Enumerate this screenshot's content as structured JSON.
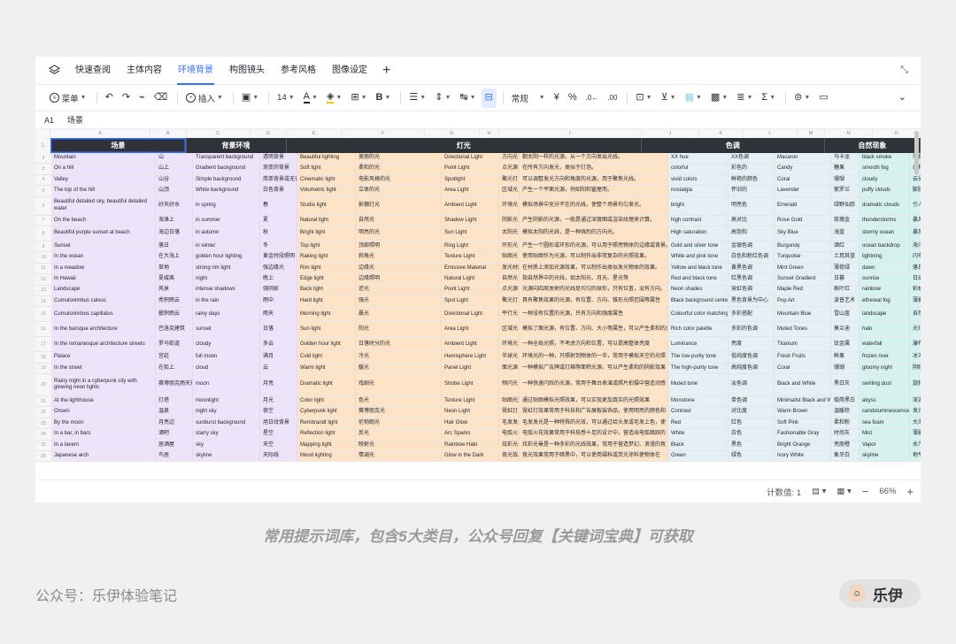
{
  "tabs": [
    "快速查阅",
    "主体内容",
    "环境背景",
    "构图镜头",
    "参考风格",
    "图像设定"
  ],
  "active_tab": "环境背景",
  "toolbar": {
    "menu": "菜单",
    "insert": "插入",
    "font_size": "14",
    "format": "常规",
    "currency": "¥",
    "percent": "%"
  },
  "formula": {
    "ref": "A1",
    "value": "场景"
  },
  "col_letters": [
    "A",
    "B",
    "C",
    "D",
    "E",
    "F",
    "G",
    "H",
    "I",
    "J",
    "K",
    "L",
    "M",
    "N",
    "O"
  ],
  "groups": [
    "场景",
    "背景环境",
    "灯光",
    "色调",
    "自然现象"
  ],
  "rows": [
    [
      "2",
      "Mountain",
      "山",
      "Transparent background",
      "透明背景",
      "Beautiful lighting",
      "美丽的光",
      "Directional Light",
      "方向光",
      "朝太阳一样的光源，从一个方向发出光线。",
      "XX hue",
      "XX色调",
      "Macaron",
      "马卡龙",
      "black smoke",
      "黑色烟雾，也可换成其"
    ],
    [
      "3",
      "On a hill",
      "山上",
      "Gradient background",
      "渐变的背景",
      "Soft light",
      "柔和的光",
      "Point Light",
      "点光源",
      "在所有方向发光，类似于灯泡。",
      "colorful",
      "彩色的",
      "Candy",
      "糖果",
      "smooth fog",
      "柔和的雾"
    ],
    [
      "4",
      "Valley",
      "山谷",
      "Simple background",
      "简单背景或无背景",
      "Cinematic light",
      "电影风格的光",
      "Spotlight",
      "聚光灯",
      "可以调整发光方向和角度的光源，用于聚焦光线。",
      "vivid colors",
      "鲜艳的颜色",
      "Coral",
      "珊瑚",
      "cloudy",
      "云朵"
    ],
    [
      "5",
      "The top of the hill",
      "山顶",
      "White background",
      "白色背景",
      "Volumetric light",
      "立体的光",
      "Area Light",
      "区域光",
      "产生一个平面光源，例如阳和窗屋而。",
      "nostalgia",
      "怀旧的",
      "Lavender",
      "紫罗兰",
      "puffy clouds",
      "膨胀的云"
    ],
    [
      "6",
      "Beautiful detailed sky, beautiful detailed water",
      "好天好水",
      "in spring",
      "春",
      "Studio light",
      "影棚灯光",
      "Ambient Light",
      "环境光",
      "模拟场景中充分不在的光线，使整个场景均匀发光。",
      "bright",
      "明亮色",
      "Emerald",
      "绿野仙踪",
      "dramatic clouds",
      "引人注目的云"
    ],
    [
      "7",
      "On the beach",
      "海滩上",
      "in summer",
      "夏",
      "Natural light",
      "自然光",
      "Shadow Light",
      "阴影光",
      "产生阴影的光源，一般是通过深度图或渲染纹理来计算。",
      "high contrast",
      "高对比",
      "Rose Gold",
      "玫瑰金",
      "thunderstorms",
      "暴风雨"
    ],
    [
      "8",
      "Beautiful purple sunset at beach",
      "海边日落",
      "in autumn",
      "秋",
      "Bright light",
      "明亮的光",
      "Sun Light",
      "太阳光",
      "模拟太阳的光线，是一种强烈的方向光。",
      "High saturation",
      "高饱和",
      "Sky Blue",
      "浅蓝",
      "stormy ocean",
      "暴风雨的海洋"
    ],
    [
      "9",
      "Sunset",
      "落日",
      "in winter",
      "冬",
      "Top light",
      "顶部照明",
      "Ring Light",
      "环形光",
      "产生一个圆形或环形的光源，可以用于照亮物体的边缘或背景。",
      "Gold and silver tone",
      "金银色调",
      "Burgundy",
      "酒红",
      "ocean backdrop",
      "海洋背景"
    ],
    [
      "10",
      "In the ocean",
      "在大海上",
      "golden hour lighting",
      "黄金时段照明",
      "Raking light",
      "斜角光",
      "Texture Light",
      "贴图光",
      "使用贴图作为光源，可以制作出非常复杂的光照效果。",
      "White and pink tone",
      "白色和粉红色调",
      "Turquoise",
      "土耳其蓝",
      "lightning",
      "闪电"
    ],
    [
      "11",
      "In a meadow",
      "草地",
      "strong rim light",
      "强边缘光",
      "Rim light",
      "边缘光",
      "Emissive Material",
      "发光材质",
      "在材质上添加光源效果，可以制作出类似发光物体的效果。",
      "Yellow and black tone",
      "黄黑色调",
      "Mint Green",
      "薄荷绿",
      "dawn",
      "落日"
    ],
    [
      "12",
      "In Hawaii",
      "夏威夷",
      "night",
      "晚上",
      "Edge light",
      "边缘照明",
      "Natural Light",
      "自然光",
      "指自然界中的光线，如太阳光、月光、星光等",
      "Red and black tone",
      "红黑色调",
      "Sunset Gradient",
      "日暮",
      "sunrise",
      "日出"
    ],
    [
      "13",
      "Landscape",
      "风景",
      "intense shadows",
      "强阴影",
      "Back light",
      "逆光",
      "Point Light",
      "点光源",
      "光源向四周发射的光线是均匀的球形，只有位置，没有方向。",
      "Neon shades",
      "霓虹色调",
      "Maple Red",
      "枫叶红",
      "rainbow",
      "彩虹"
    ],
    [
      "14",
      "Cumulonimbus calvus",
      "秃积雨云",
      "in the rain",
      "雨中",
      "Hard light",
      "强光",
      "Spot Light",
      "聚光灯",
      "具有聚焦效果的光源，有位置、方向、锥形光照范围等属性",
      "Black background centered",
      "黑色背景为中心",
      "Pop Art",
      "波普艺术",
      "ethereal fog",
      "薄雾"
    ],
    [
      "15",
      "Cumulonimbus capillatus",
      "鬃积雨云",
      "rainy days",
      "雨天",
      "Morning light",
      "晨光",
      "Directional Light",
      "平行光",
      "一种没有位置的光源，只有方向和强度属性",
      "Colourful color matching",
      "多彩搭配",
      "Mountain Blue",
      "雪山蓝",
      "landscape",
      "自然风景"
    ],
    [
      "16",
      "In the baroque architecture",
      "巴洛克建筑",
      "sunset",
      "日落",
      "Sun light",
      "阳光",
      "Area Light",
      "区域光",
      "模拟了面光源，有位置、方向、大小等属性，可以产生柔和的光",
      "Rich color palette",
      "多彩的色调",
      "Muted Tones",
      "莫兰迪",
      "halo",
      "光环"
    ],
    [
      "17",
      "In the romanesque architecture streets",
      "罗马街道",
      "cloudy",
      "多云",
      "Golden hour light",
      "日落时分的光",
      "Ambient Light",
      "环境光",
      "一种全局光照，不考虑方向和位置，可以提高整体亮度",
      "Luminance",
      "亮度",
      "Titanium",
      "钛金属",
      "waterfall",
      "瀑布"
    ],
    [
      "18",
      "Palace",
      "宫廷",
      "full moon",
      "满月",
      "Cold light",
      "冷光",
      "Hemisphere Light",
      "半球光",
      "环境光的一种，只照射到物体的一半，常用于模拟天空的光照",
      "The low-purity tone",
      "低纯度色调",
      "Fresh Fruits",
      "鲜果",
      "frozen river",
      "冰河"
    ],
    [
      "19",
      "In the street",
      "在街上",
      "cloud",
      "云",
      "Warm light",
      "暖光",
      "Panel Light",
      "面光源",
      "一种模拟广告牌或灯箱等面积光源，可以产生柔和的阴影效果",
      "The high-purity tone",
      "高纯度色调",
      "Coral",
      "珊瑚",
      "gloomy night",
      "阴暗的夜"
    ],
    [
      "20",
      "Rainy night in a cyberpunk city with glowing neon lights",
      "赛博朋克雨天霓虹灯",
      "moon",
      "月亮",
      "Dramatic light",
      "戏剧光",
      "Strobe Light",
      "频闪光",
      "一种快速闪烁的光源，常用于舞台表演或照片拍摄中营造动感",
      "Muted tone",
      "淡色调",
      "Black and White",
      "黑白灰",
      "swirling dust",
      "旋转的尘埃"
    ],
    [
      "21",
      "At the lighthouse",
      "灯塔",
      "moonlight",
      "月光",
      "Color light",
      "色光",
      "Texture Light",
      "贴图光源",
      "通过贴图模拟光照效果，可以实现更加真实的光照效果",
      "Monotone",
      "单色调",
      "Minimalist Black and White",
      "极简黑白",
      "abyss",
      "深渊"
    ],
    [
      "22",
      "Onsen",
      "温泉",
      "night sky",
      "夜空",
      "Cyberpunk light",
      "赛博朋克光",
      "Neon Light",
      "霓虹灯",
      "霓虹灯效果常用于科技和广告展板装饰品，使用明亮的颜色和",
      "Contrast",
      "对比度",
      "Warm Brown",
      "温暖棕",
      "candoluminescence",
      "发光现象"
    ],
    [
      "23",
      "By the moon",
      "月亮边",
      "sunburst background",
      "旭日纹背景",
      "Rembrandt light",
      "伦勃朗光",
      "Hair Glow",
      "毛发发光",
      "毛发发光是一种特殊的光效，可以通过给头发或毛发上色，使",
      "Red",
      "红色",
      "Soft Pink",
      "柔和粉",
      "sea foam",
      "大海溶花前的白色泡沫"
    ],
    [
      "24",
      "In a bar, in bars",
      "酒吧",
      "starry sky",
      "星空",
      "Reflection light",
      "反光",
      "Arc Sparks",
      "电弧火花",
      "电弧火花效果常用于科技感十足的设计中，营造出电弧跳跃的",
      "White",
      "白色",
      "Fashionable Gray",
      "时尚灰",
      "Mist",
      "薄雾"
    ],
    [
      "25",
      "In a tavern",
      "居酒屋",
      "sky",
      "天空",
      "Mapping light",
      "映射光",
      "Rainbow Halo",
      "炫彩光晕",
      "炫彩光晕是一种多彩的光线效果，常用于营造梦幻、浪漫的氛",
      "Black",
      "黑色",
      "Bright Orange",
      "亮丽橙",
      "Vapor",
      "水汽"
    ],
    [
      "26",
      "Japanese arch",
      "鸟居",
      "skyline",
      "天际线",
      "Mood lighting",
      "情调光",
      "Glow in the Dark",
      "夜光效果",
      "夜光效果常用于暗黑中，可以使用福科或荧光涂料使物体在",
      "Green",
      "绿色",
      "Ivory White",
      "象牙白",
      "skyline",
      "地平线"
    ]
  ],
  "status": {
    "count_label": "计数值: 1",
    "zoom": "66%"
  },
  "caption": "常用提示词库，包含5大类目，公众号回复【关键词宝典】可获取",
  "footer_left": "公众号：乐伊体验笔记",
  "badge": "乐伊"
}
